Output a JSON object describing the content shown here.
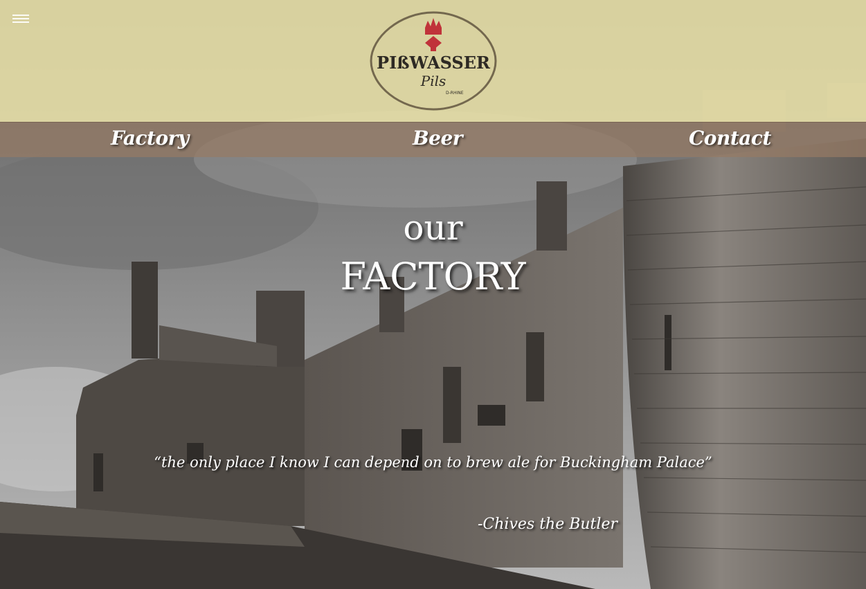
{
  "header": {
    "menu_icon": "hamburger-menu-icon",
    "logo": {
      "brand": "PIßWASSER",
      "product": "Pils",
      "origin": "D-RHINE",
      "crown_icon": "crown-icon",
      "colors": {
        "border": "#5a4e3a",
        "crown": "#c0333a",
        "text": "#2e2a24"
      }
    }
  },
  "nav": {
    "items": [
      {
        "label": "Factory"
      },
      {
        "label": "Beer"
      },
      {
        "label": "Contact"
      }
    ]
  },
  "hero": {
    "title_small": "our",
    "title_big": "FACTORY",
    "quote": "“the only place I know I can depend on to brew ale for Buckingham Palace”",
    "author": "-Chives the Butler"
  },
  "colors": {
    "top_band": "#ece4aa",
    "nav_band": "#967a64",
    "text": "#ffffff"
  }
}
